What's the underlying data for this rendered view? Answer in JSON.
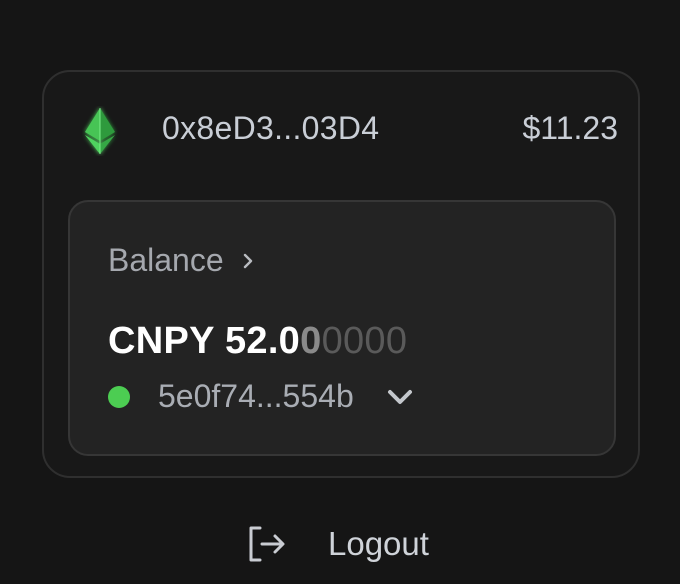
{
  "account": {
    "network_icon": "ethereum-icon",
    "address": "0x8eD3...03D4",
    "usd_value": "$11.23"
  },
  "balance": {
    "label": "Balance",
    "token": "CNPY",
    "amount_bright": "52.0",
    "amount_mid": "0",
    "amount_dim": "0000",
    "key_address": "5e0f74...554b",
    "status_color": "#4ccd52"
  },
  "logout": {
    "label": "Logout"
  }
}
